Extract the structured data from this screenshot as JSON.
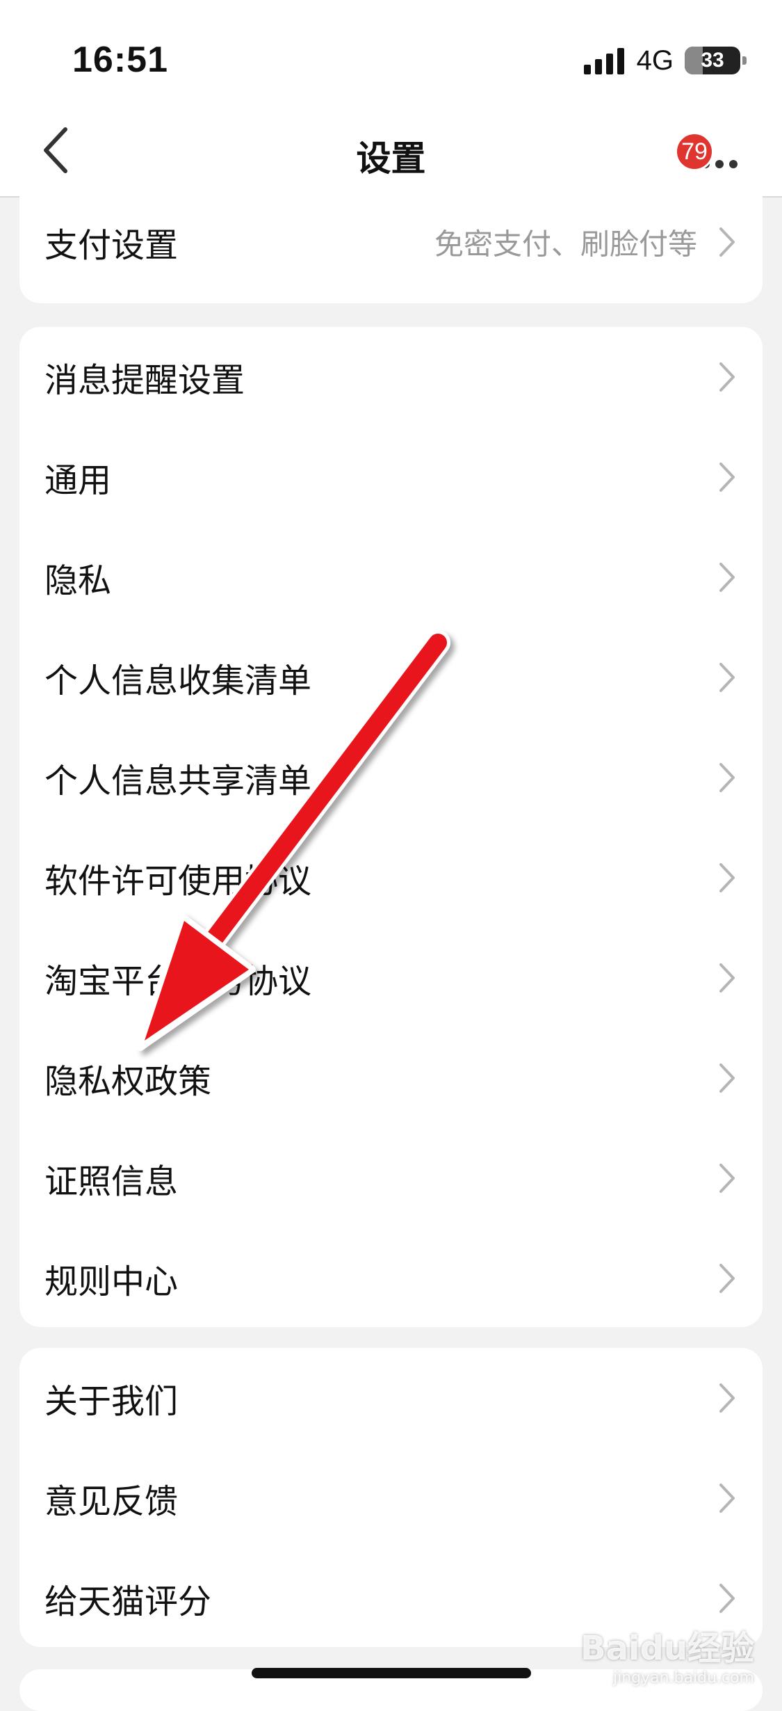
{
  "status_bar": {
    "time": "16:51",
    "network": "4G",
    "battery": "33",
    "battery_level": 0.33
  },
  "nav": {
    "title": "设置",
    "badge_count": "79",
    "back_icon": "chevron-left-icon",
    "more_icon": "more-dots-icon"
  },
  "group1": [
    {
      "label": "支付设置",
      "value": "免密支付、刷脸付等"
    }
  ],
  "group2": [
    {
      "label": "消息提醒设置"
    },
    {
      "label": "通用"
    },
    {
      "label": "隐私"
    },
    {
      "label": "个人信息收集清单"
    },
    {
      "label": "个人信息共享清单"
    },
    {
      "label": "软件许可使用协议"
    },
    {
      "label": "淘宝平台服务协议"
    },
    {
      "label": "隐私权政策"
    },
    {
      "label": "证照信息"
    },
    {
      "label": "规则中心"
    }
  ],
  "group3": [
    {
      "label": "关于我们"
    },
    {
      "label": "意见反馈"
    },
    {
      "label": "给天猫评分"
    }
  ],
  "annotation": {
    "arrow_color": "#e8151b",
    "arrow_target": "隐私权政策"
  },
  "watermark": {
    "text": "Baidu经验",
    "sub": "jingyan.baidu.com"
  }
}
